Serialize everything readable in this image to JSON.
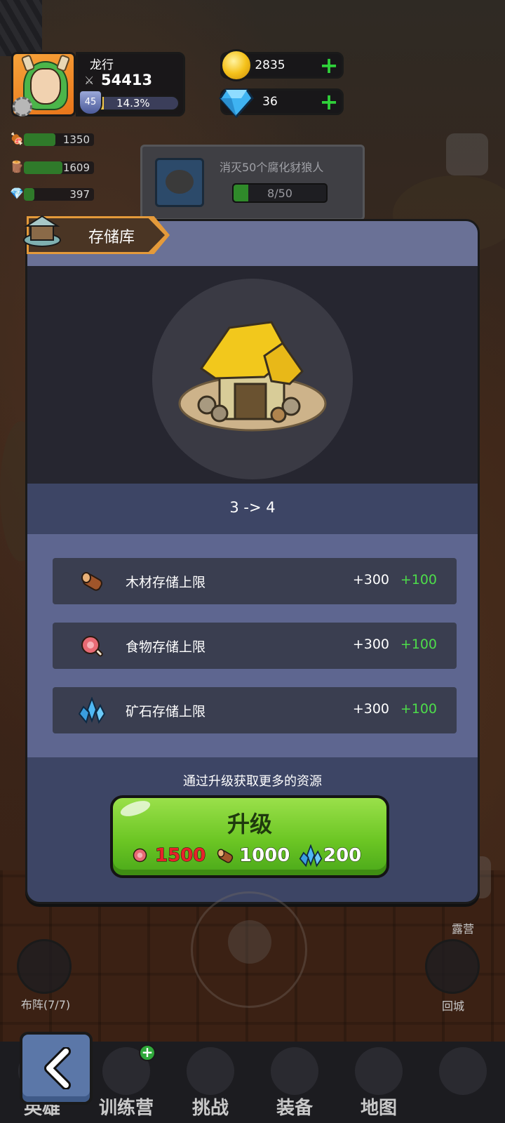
{
  "player": {
    "name": "龙行",
    "power": "54413",
    "level": "45",
    "xp_percent_label": "14.3%",
    "xp_fraction": 0.143
  },
  "currency": {
    "gold": "2835",
    "gems": "36"
  },
  "resources": [
    {
      "icon": "meat-icon",
      "value": "1350",
      "fill": 0.45
    },
    {
      "icon": "wood-icon",
      "value": "1609",
      "fill": 0.55
    },
    {
      "icon": "crystal-icon",
      "value": "397",
      "fill": 0.15
    }
  ],
  "quest": {
    "title": "消灭50个腐化豺狼人",
    "progress_text": "8/50",
    "progress_fraction": 0.16
  },
  "dialog": {
    "title": "存储库",
    "level_change": "3 -> 4",
    "stats": [
      {
        "icon": "wood-icon",
        "label": "木材存储上限",
        "current": "+300",
        "added": "+100"
      },
      {
        "icon": "meat-icon",
        "label": "食物存储上限",
        "current": "+300",
        "added": "+100"
      },
      {
        "icon": "crystal-icon",
        "label": "矿石存储上限",
        "current": "+300",
        "added": "+100"
      }
    ],
    "hint": "通过升级获取更多的资源",
    "upgrade_label": "升级",
    "costs": [
      {
        "icon": "meat-icon",
        "amount": "1500",
        "color": "#e8232a"
      },
      {
        "icon": "wood-icon",
        "amount": "1000",
        "color": "#ffffff"
      },
      {
        "icon": "crystal-icon",
        "amount": "200",
        "color": "#ffffff"
      }
    ]
  },
  "side_buttons": {
    "camp_label": "露营",
    "formation_label": "布阵(7/7)",
    "return_label": "回城"
  },
  "nav": [
    {
      "label": "英雄",
      "icon": "hero-icon"
    },
    {
      "label": "训练营",
      "icon": "training-icon"
    },
    {
      "label": "挑战",
      "icon": "sword-icon"
    },
    {
      "label": "装备",
      "icon": "armor-icon"
    },
    {
      "label": "地图",
      "icon": "map-icon"
    },
    {
      "label": "",
      "icon": "lock-icon"
    }
  ],
  "colors": {
    "accent_green": "#4ddd4a",
    "cost_red": "#e8232a",
    "dialog_bg": "#3d4565"
  }
}
